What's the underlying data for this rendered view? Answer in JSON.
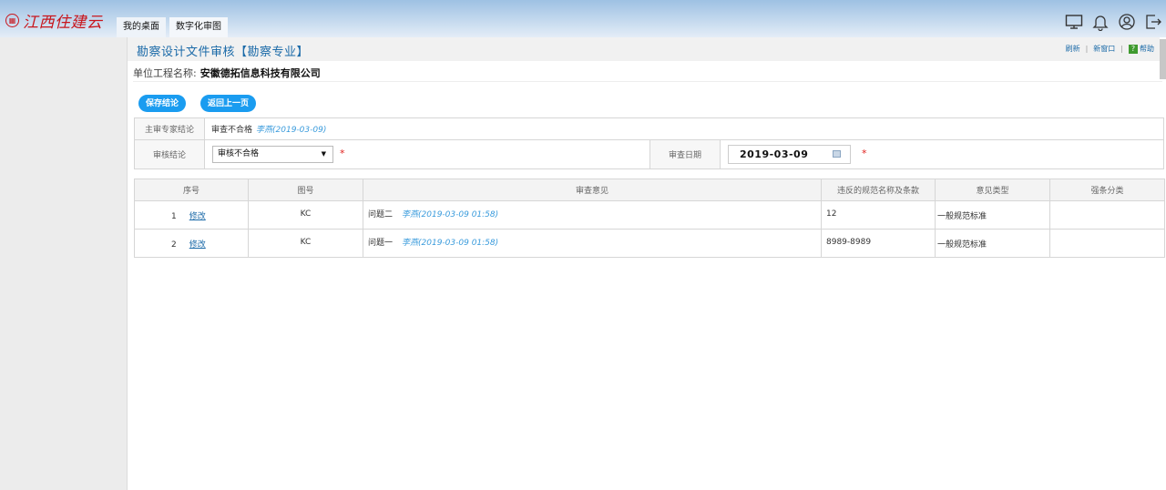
{
  "app": {
    "logo_text": "江西住建云",
    "nav_tabs": [
      "我的桌面",
      "数字化审图"
    ]
  },
  "header": {
    "title": "勘察设计文件审核【勘察专业】",
    "actions": {
      "refresh": "刷新",
      "new_window": "新窗口",
      "help": "帮助"
    },
    "unit_label": "单位工程名称:",
    "unit_name": "安徽德拓信息科技有限公司"
  },
  "buttons": {
    "save": "保存结论",
    "back": "返回上一页"
  },
  "form": {
    "expert_conclusion_label": "主审专家结论",
    "expert_conclusion_value": "审查不合格",
    "expert_conclusion_who": "李燕(2019-03-09)",
    "review_conclusion_label": "审核结论",
    "review_conclusion_value": "审核不合格",
    "review_date_label": "审查日期",
    "review_date_value": "2019-03-09",
    "required_mark": "*"
  },
  "table": {
    "headers": [
      "序号",
      "图号",
      "审查意见",
      "违反的规范名称及条款",
      "意见类型",
      "强条分类"
    ],
    "rows": [
      {
        "seq": "1",
        "edit": "修改",
        "figure": "KC",
        "opinion": "问题二",
        "opinion_who": "李燕(2019-03-09 01:58)",
        "code": "12",
        "type": "一般规范标准",
        "mandatory": ""
      },
      {
        "seq": "2",
        "edit": "修改",
        "figure": "KC",
        "opinion": "问题一",
        "opinion_who": "李燕(2019-03-09 01:58)",
        "code": "8989-8989",
        "type": "一般规范标准",
        "mandatory": ""
      }
    ]
  },
  "colors": {
    "accent": "#1a9cf0",
    "link": "#1b6aa8",
    "logo": "#c8161d",
    "required": "#e0211d",
    "opinion_type": "#f07d00"
  },
  "icons": [
    "screen-icon",
    "bell-icon",
    "user-icon",
    "logout-icon",
    "calendar-icon",
    "help-icon"
  ]
}
